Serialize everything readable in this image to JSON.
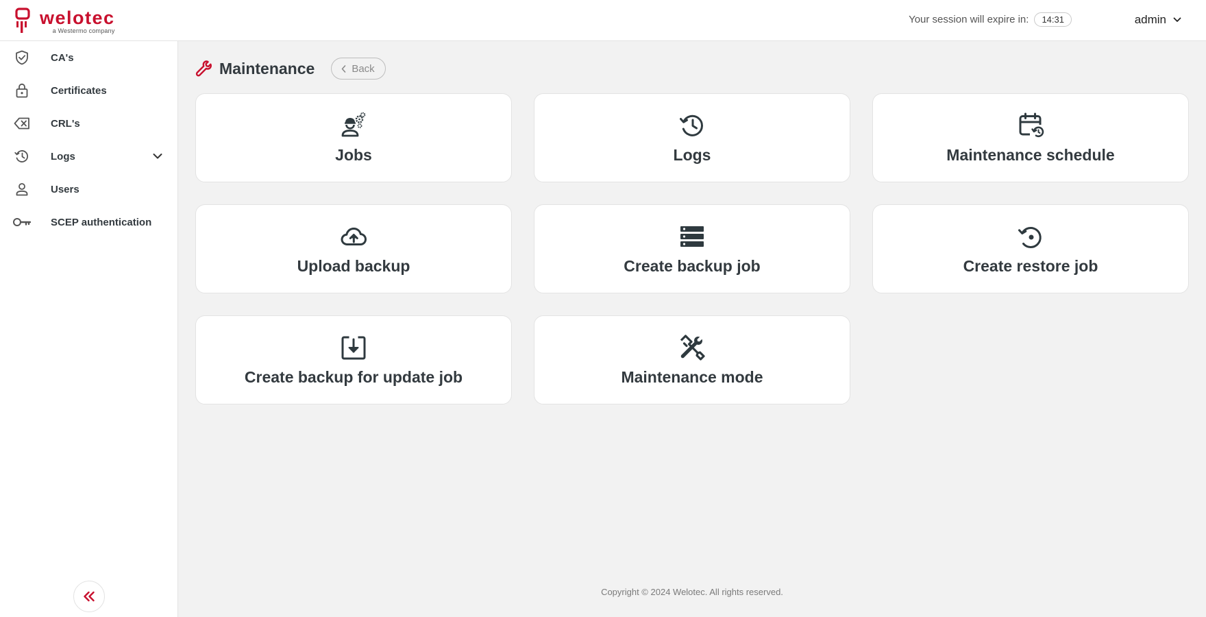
{
  "brand": {
    "name": "welotec",
    "tagline": "a Westermo company",
    "color": "#c8102e"
  },
  "header": {
    "session_label": "Your session will expire in:",
    "session_timer": "14:31",
    "user": "admin"
  },
  "sidebar": {
    "items": [
      {
        "label": "CA's",
        "icon": "shield-check-icon"
      },
      {
        "label": "Certificates",
        "icon": "lock-icon"
      },
      {
        "label": "CRL's",
        "icon": "backspace-x-icon"
      },
      {
        "label": "Logs",
        "icon": "history-icon",
        "expandable": true
      },
      {
        "label": "Users",
        "icon": "user-icon"
      },
      {
        "label": "SCEP authentication",
        "icon": "key-icon"
      }
    ]
  },
  "page": {
    "title": "Maintenance",
    "title_icon": "wrench-icon",
    "back_label": "Back"
  },
  "cards": [
    {
      "label": "Jobs",
      "icon": "worker-gears-icon"
    },
    {
      "label": "Logs",
      "icon": "history-icon"
    },
    {
      "label": "Maintenance schedule",
      "icon": "calendar-restore-icon"
    },
    {
      "label": "Upload backup",
      "icon": "cloud-upload-icon"
    },
    {
      "label": "Create backup job",
      "icon": "server-stack-icon"
    },
    {
      "label": "Create restore job",
      "icon": "restore-icon"
    },
    {
      "label": "Create backup for update job",
      "icon": "download-box-icon"
    },
    {
      "label": "Maintenance mode",
      "icon": "tools-icon"
    }
  ],
  "footer": {
    "copyright": "Copyright © 2024 Welotec. All rights reserved."
  }
}
